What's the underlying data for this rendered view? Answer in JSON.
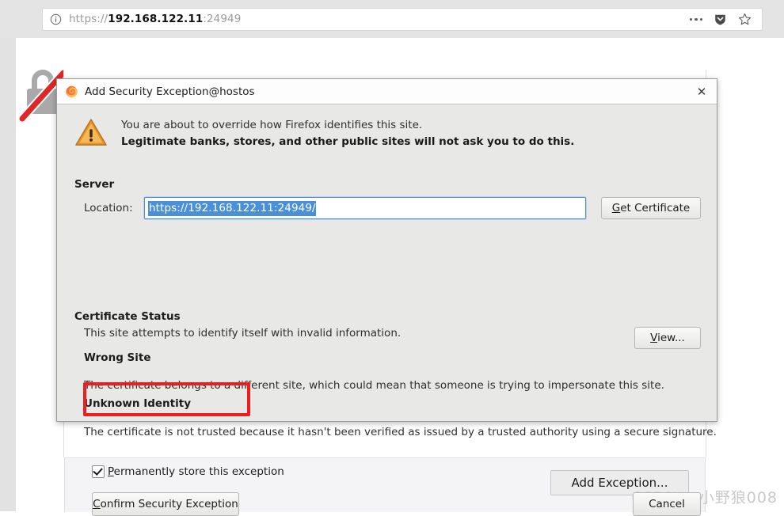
{
  "browser": {
    "url": {
      "scheme": "https://",
      "host": "192.168.122.11",
      "port": ":24949"
    },
    "identity_icon": "info-circle-icon",
    "actions": [
      {
        "name": "page-actions-icon",
        "glyph": "…"
      },
      {
        "name": "pocket-shield-icon",
        "glyph": "▼"
      },
      {
        "name": "bookmark-star-icon",
        "glyph": "☆"
      }
    ]
  },
  "page": {
    "broken_lock_icon": "broken-padlock-icon",
    "add_exception_button": "Add Exception...",
    "watermark": "CSDN @小野狼008"
  },
  "dialog": {
    "title": "Add Security Exception@hostos",
    "close_label": "✕",
    "warning_icon": "warning-triangle-icon",
    "intro_line1": "You are about to override how Firefox identifies this site.",
    "intro_line2": "Legitimate banks, stores, and other public sites will not ask you to do this.",
    "server_heading": "Server",
    "location_label": "Location:",
    "location_value": "https://192.168.122.11:24949/",
    "get_certificate_button": {
      "mnemonic": "G",
      "rest": "et Certificate"
    },
    "cert_status_heading": "Certificate Status",
    "cert_status_line": "This site attempts to identify itself with invalid information.",
    "view_button": {
      "mnemonic": "V",
      "rest": "iew..."
    },
    "wrong_site_heading": "Wrong Site",
    "wrong_site_body": "The certificate belongs to a different site, which could mean that someone is trying to impersonate this site.",
    "unknown_identity_heading": "Unknown Identity",
    "unknown_identity_body": "The certificate is not trusted because it hasn't been verified as issued by a trusted authority using a secure signature.",
    "permanent_checkbox": {
      "checked": true,
      "mnemonic": "P",
      "rest": "ermanently store this exception"
    },
    "confirm_button": {
      "mnemonic": "C",
      "rest": "onfirm Security Exception"
    },
    "cancel_button": "Cancel",
    "highlight_color": "#ef1d1d"
  }
}
